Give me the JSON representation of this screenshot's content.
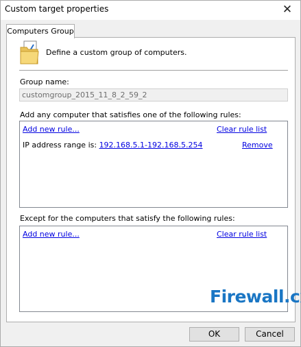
{
  "window": {
    "title": "Custom target properties",
    "close_glyph": "✕"
  },
  "tabs": [
    {
      "label": "Computers Group"
    }
  ],
  "header": {
    "icon": "folder-icon",
    "description": "Define a custom group of computers."
  },
  "group_name": {
    "label": "Group name:",
    "value": "customgroup_2015_11_8_2_59_2"
  },
  "include_rules": {
    "label": "Add any computer that satisfies one of the following rules:",
    "add_link": "Add new rule...",
    "clear_link": "Clear rule list",
    "rules": [
      {
        "prefix": "IP address range is: ",
        "value": "192.168.5.1-192.168.5.254",
        "remove_label": "Remove"
      }
    ]
  },
  "exclude_rules": {
    "label": "Except for the computers that satisfy the following rules:",
    "add_link": "Add new rule...",
    "clear_link": "Clear rule list"
  },
  "watermark": {
    "text_main": "Firewall",
    "text_suffix": ".cx"
  },
  "buttons": {
    "ok": "OK",
    "cancel": "Cancel"
  },
  "colors": {
    "link": "#0000e0",
    "watermark": "#1a76c4"
  }
}
